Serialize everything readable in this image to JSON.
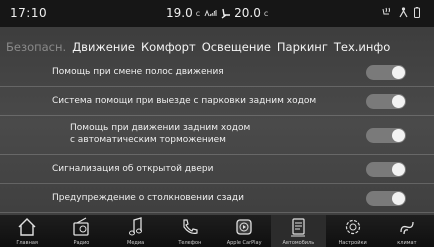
{
  "status": {
    "time": "17:10",
    "temp_left": "19.0",
    "temp_unit_left": "c",
    "temp_right": "20.0",
    "temp_unit_right": "c"
  },
  "tabs": [
    {
      "label": "Безопасн.",
      "active": false
    },
    {
      "label": "Движение",
      "active": true
    },
    {
      "label": "Комфорт",
      "active": true
    },
    {
      "label": "Освещение",
      "active": true
    },
    {
      "label": "Паркинг",
      "active": true
    },
    {
      "label": "Тех.инфо",
      "active": true
    }
  ],
  "settings": [
    {
      "label": "Помощь при смене полос движения",
      "on": true
    },
    {
      "label": "Система помощи при выезде с парковки задним ходом",
      "on": true
    },
    {
      "label_line1": "Помощь при движении задним ходом",
      "label_line2": "с автоматическим торможением",
      "on": true
    },
    {
      "label": "Сигнализация об открытой двери",
      "on": true
    },
    {
      "label": "Предупреждение о столкновении сзади",
      "on": true
    }
  ],
  "nav": [
    {
      "label": "Главная",
      "icon": "home-icon"
    },
    {
      "label": "Радио",
      "icon": "radio-icon"
    },
    {
      "label": "Медиа",
      "icon": "music-icon"
    },
    {
      "label": "Телефон",
      "icon": "phone-icon"
    },
    {
      "label": "Apple CarPlay",
      "icon": "carplay-icon"
    },
    {
      "label": "Автомобиль",
      "icon": "vehicle-icon"
    },
    {
      "label": "Настройки",
      "icon": "settings-icon"
    },
    {
      "label": "климат",
      "icon": "climate-icon"
    }
  ]
}
